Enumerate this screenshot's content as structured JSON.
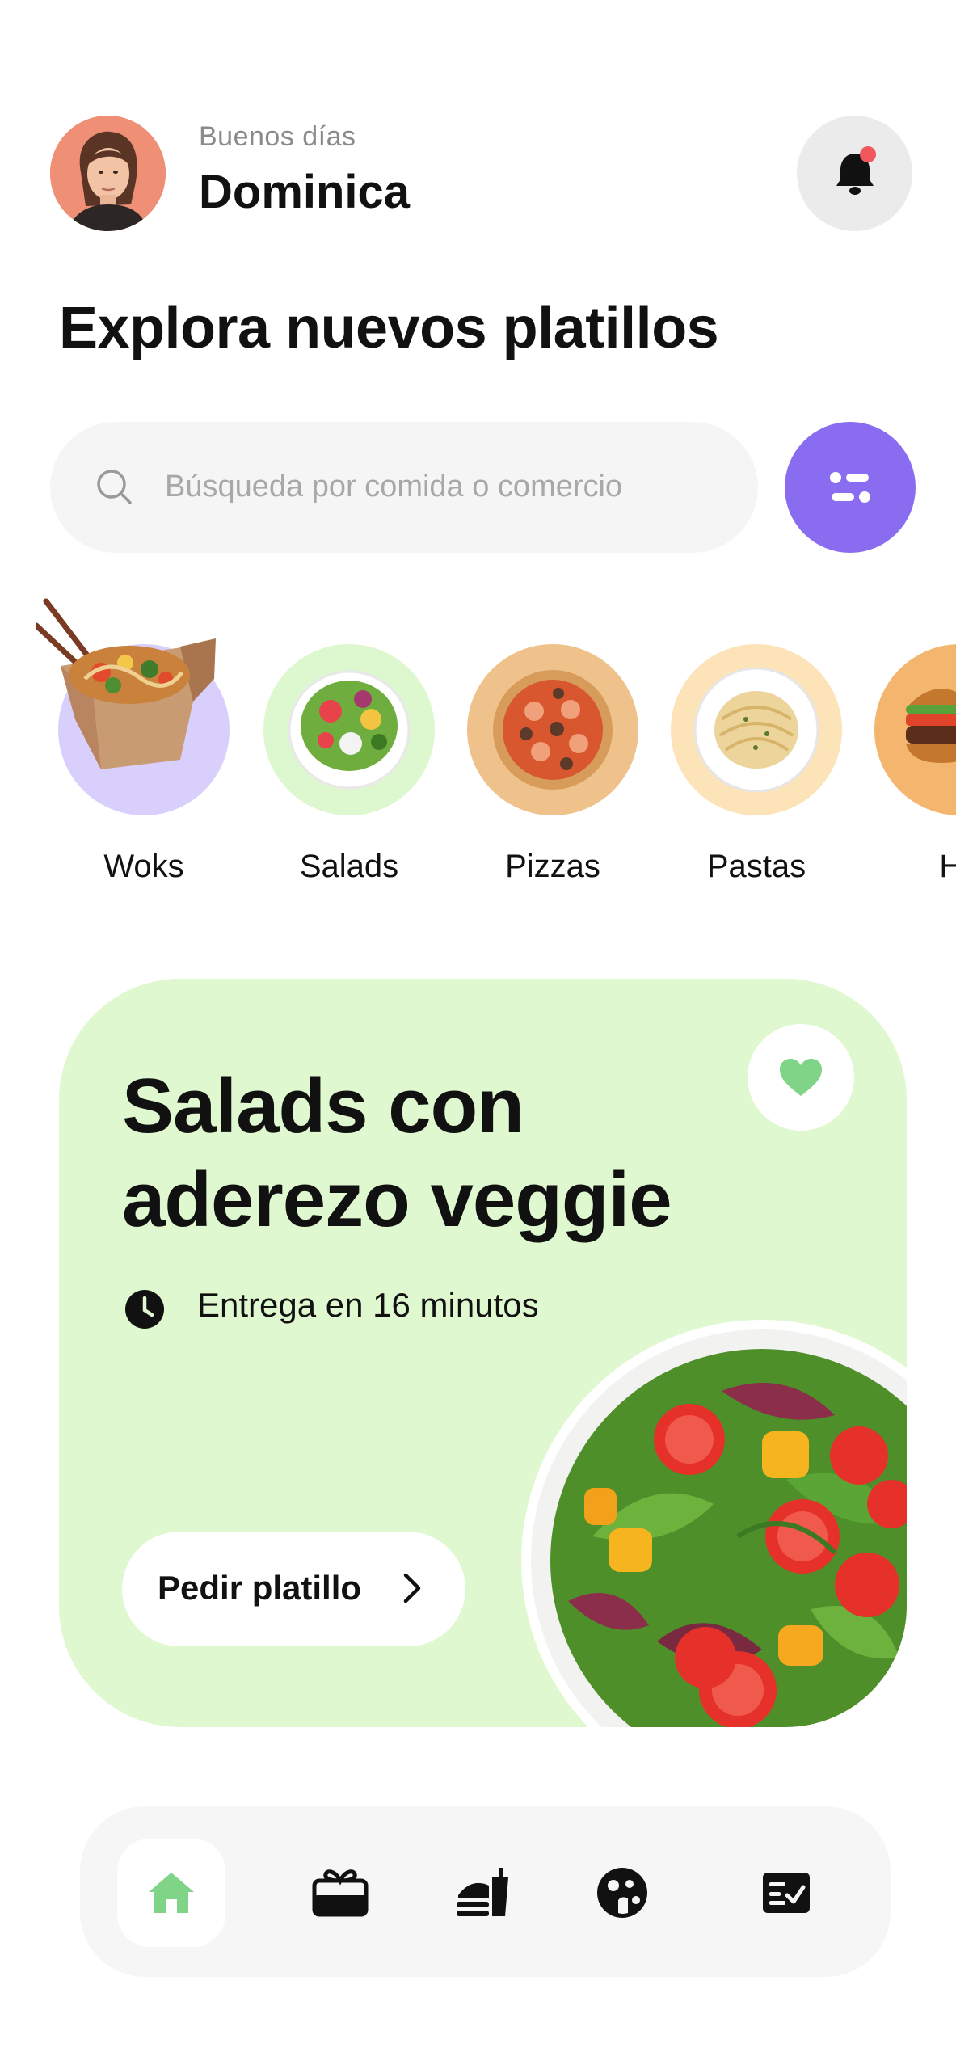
{
  "header": {
    "greeting": "Buenos días",
    "user_name": "Dominica",
    "has_notification": true
  },
  "page_title": "Explora nuevos platillos",
  "search": {
    "placeholder": "Búsqueda por comida o comercio",
    "value": ""
  },
  "categories": [
    {
      "label": "Woks",
      "bg": "#d9cffc"
    },
    {
      "label": "Salads",
      "bg": "#ddf7cf"
    },
    {
      "label": "Pizzas",
      "bg": "#efc28c"
    },
    {
      "label": "Pastas",
      "bg": "#fde3b8"
    },
    {
      "label": "Ha",
      "bg": "#f4b56e"
    }
  ],
  "promo": {
    "title_line1": "Salads con",
    "title_line2": "aderezo veggie",
    "delivery": "Entrega en 16 minutos",
    "cta": "Pedir platillo",
    "favorite_color": "#7fd487"
  },
  "bottom_nav": {
    "items": [
      "home-icon",
      "gift-box-icon",
      "food-delivery-icon",
      "cookie-icon",
      "checklist-icon"
    ],
    "active": "home-icon",
    "active_color": "#7fd487"
  },
  "colors": {
    "accent": "#8a6cf0",
    "promo_bg": "#dff8cf",
    "notification_dot": "#f2575e"
  }
}
